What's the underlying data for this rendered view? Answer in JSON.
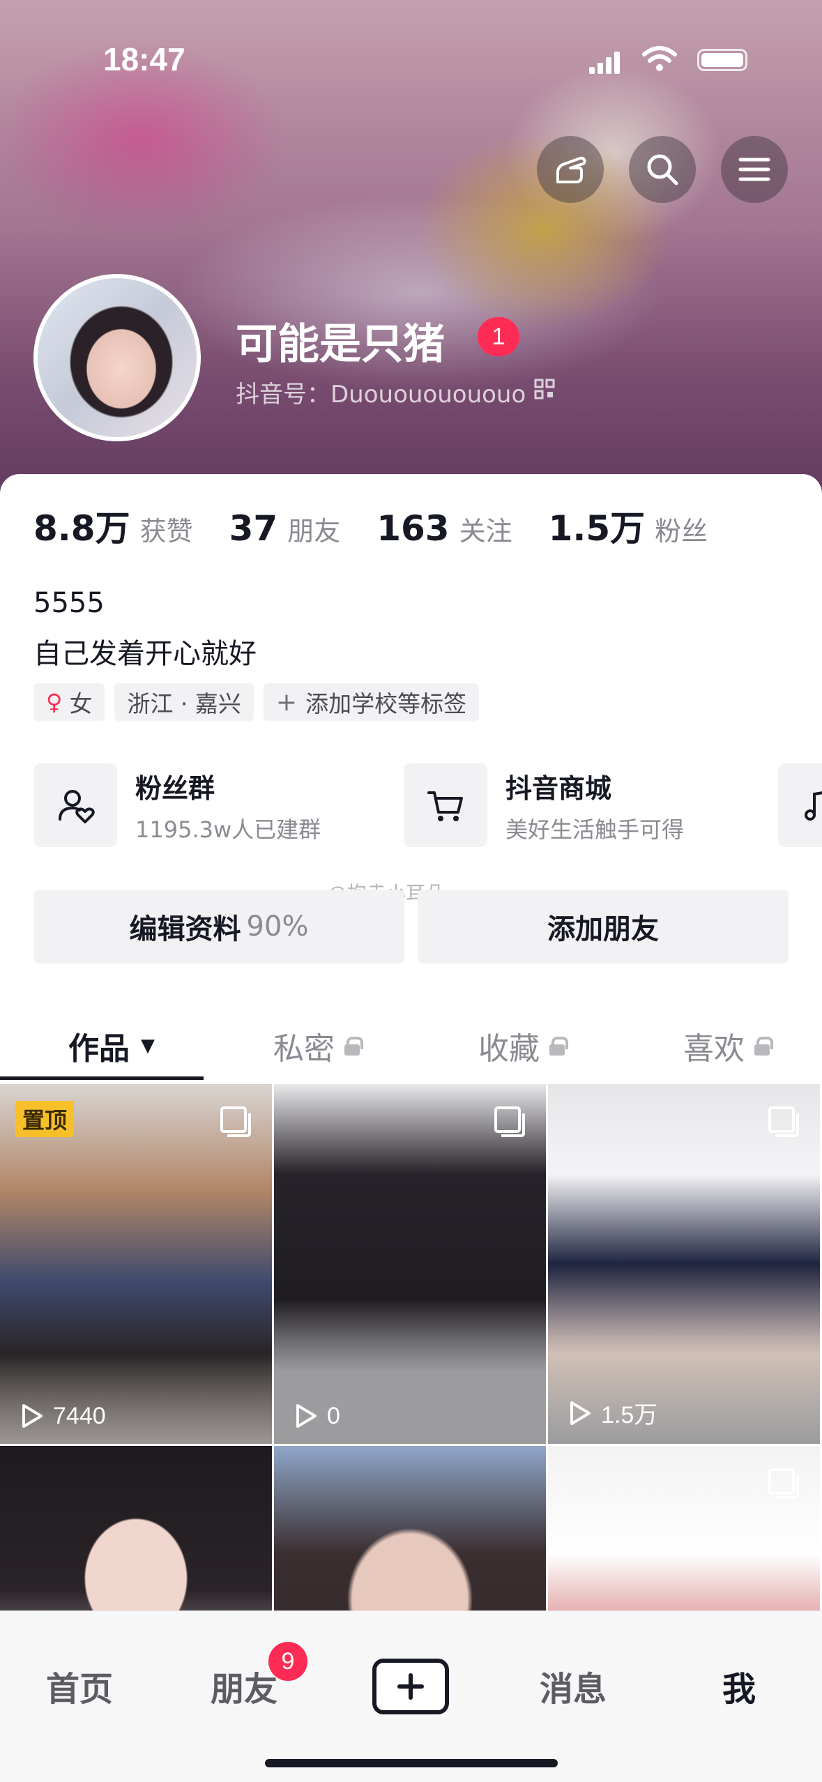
{
  "status_bar": {
    "time": "18:47"
  },
  "profile": {
    "name": "可能是只猪",
    "name_badge": "1",
    "douyin_id": "抖音号：Duouououououo"
  },
  "stats": [
    {
      "num": "8.8万",
      "label": "获赞"
    },
    {
      "num": "37",
      "label": "朋友"
    },
    {
      "num": "163",
      "label": "关注"
    },
    {
      "num": "1.5万",
      "label": "粉丝"
    }
  ],
  "bio": {
    "line1": "5555",
    "line2": "自己发着开心就好"
  },
  "tags": {
    "gender_symbol": "♀",
    "gender": "女",
    "location": "浙江 · 嘉兴",
    "add_plus": "+",
    "add": "添加学校等标签"
  },
  "cards": [
    {
      "title": "粉丝群",
      "sub": "1195.3w人已建群",
      "icon": "user-heart-icon"
    },
    {
      "title": "抖音商城",
      "sub": "美好生活触手可得",
      "icon": "cart-icon"
    }
  ],
  "watermark": "@抱走小耳朵",
  "actions": {
    "edit": "编辑资料",
    "edit_pct": "90%",
    "add_friend": "添加朋友"
  },
  "tabs": {
    "works": "作品",
    "works_caret": "▼",
    "private": "私密",
    "favorites": "收藏",
    "likes": "喜欢"
  },
  "grid": [
    {
      "pinned": "置顶",
      "plays": "7440",
      "multi": true
    },
    {
      "plays": "0",
      "multi": true
    },
    {
      "plays": "1.5万",
      "multi": true
    },
    {
      "multi": false
    },
    {
      "multi": false
    },
    {
      "multi": true
    }
  ],
  "nav": {
    "home": "首页",
    "friends": "朋友",
    "friends_badge": "9",
    "messages": "消息",
    "me": "我"
  },
  "colors": {
    "accent": "#fe2c55",
    "pin": "#f7c02b",
    "text": "#161823",
    "muted": "#8a8b91"
  }
}
